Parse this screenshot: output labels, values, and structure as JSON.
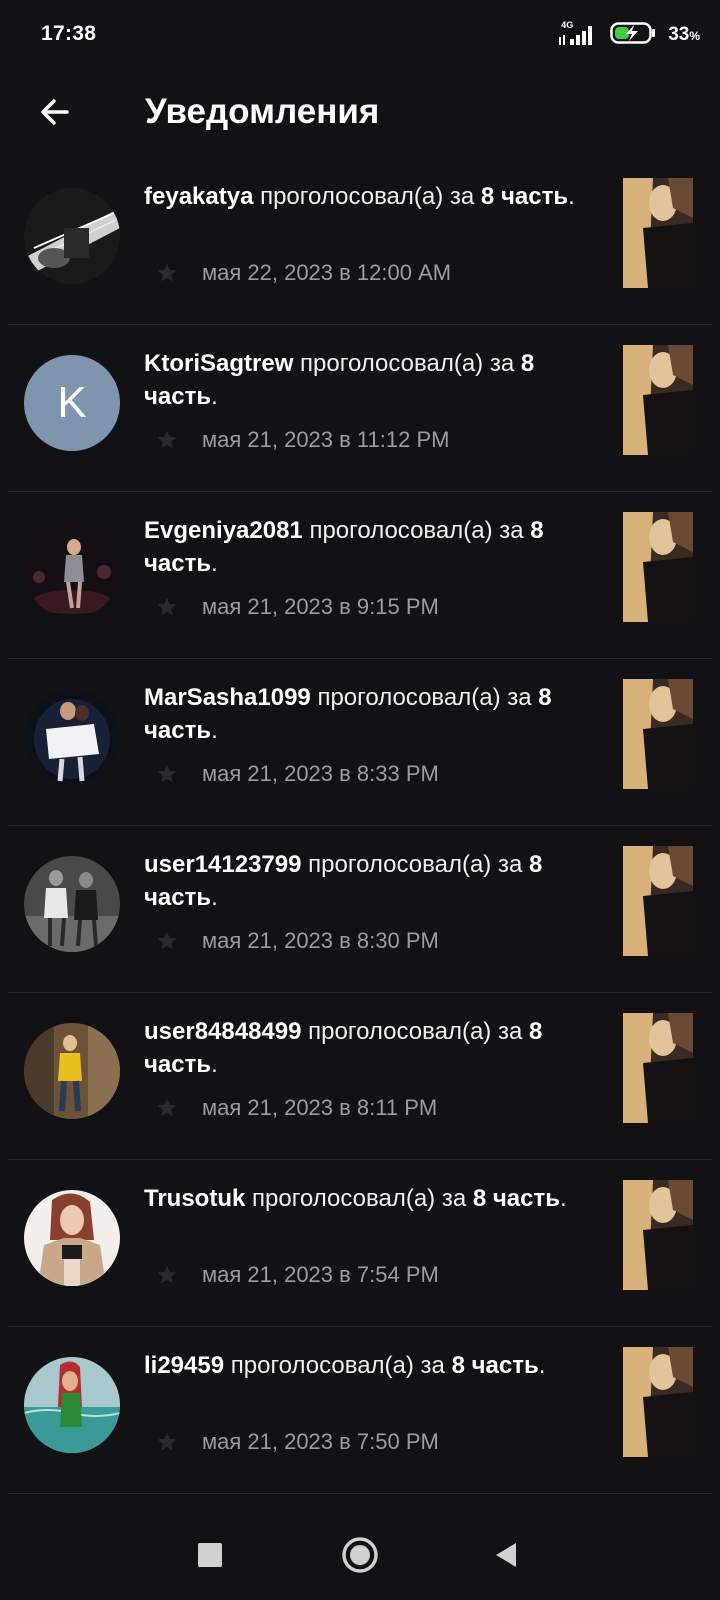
{
  "status_bar": {
    "time": "17:38",
    "network": "4G",
    "battery_percent": "33",
    "battery_unit": "%"
  },
  "header": {
    "back_icon": "arrow-left-icon",
    "title": "Уведомления"
  },
  "notifications": [
    {
      "user": "feyakatya",
      "action": " проголосовал(а) за ",
      "part": "8 часть",
      "period": ".",
      "date": "мая 22, 2023 в 12:00 AM",
      "avatar": "photo"
    },
    {
      "user": "KtoriSagtrew",
      "action": " проголосовал(а) за ",
      "part": "8 часть",
      "period": ".",
      "date": "мая 21, 2023 в 11:12 PM",
      "avatar": "letter",
      "avatar_letter": "K"
    },
    {
      "user": "Evgeniya2081",
      "action": " проголосовал(а) за ",
      "part": "8 часть",
      "period": ".",
      "date": "мая 21, 2023 в 9:15 PM",
      "avatar": "photo"
    },
    {
      "user": "MarSasha1099",
      "action": " проголосовал(а) за ",
      "part": "8 часть",
      "period": ".",
      "date": "мая 21, 2023 в 8:33 PM",
      "avatar": "photo"
    },
    {
      "user": "user14123799",
      "action": " проголосовал(а) за ",
      "part": "8 часть",
      "period": ".",
      "date": "мая 21, 2023 в 8:30 PM",
      "avatar": "photo"
    },
    {
      "user": "user84848499",
      "action": " проголосовал(а) за ",
      "part": "8 часть",
      "period": ".",
      "date": "мая 21, 2023 в 8:11 PM",
      "avatar": "photo"
    },
    {
      "user": "Trusotuk",
      "action": " проголосовал(а) за ",
      "part": "8 часть",
      "period": ".",
      "date": "мая 21, 2023 в 7:54 PM",
      "avatar": "photo"
    },
    {
      "user": "li29459",
      "action": " проголосовал(а) за ",
      "part": "8 часть",
      "period": ".",
      "date": "мая 21, 2023 в 7:50 PM",
      "avatar": "photo"
    }
  ],
  "nav_bar": {
    "recents_icon": "square-icon",
    "home_icon": "circle-icon",
    "back_icon": "triangle-back-icon"
  }
}
